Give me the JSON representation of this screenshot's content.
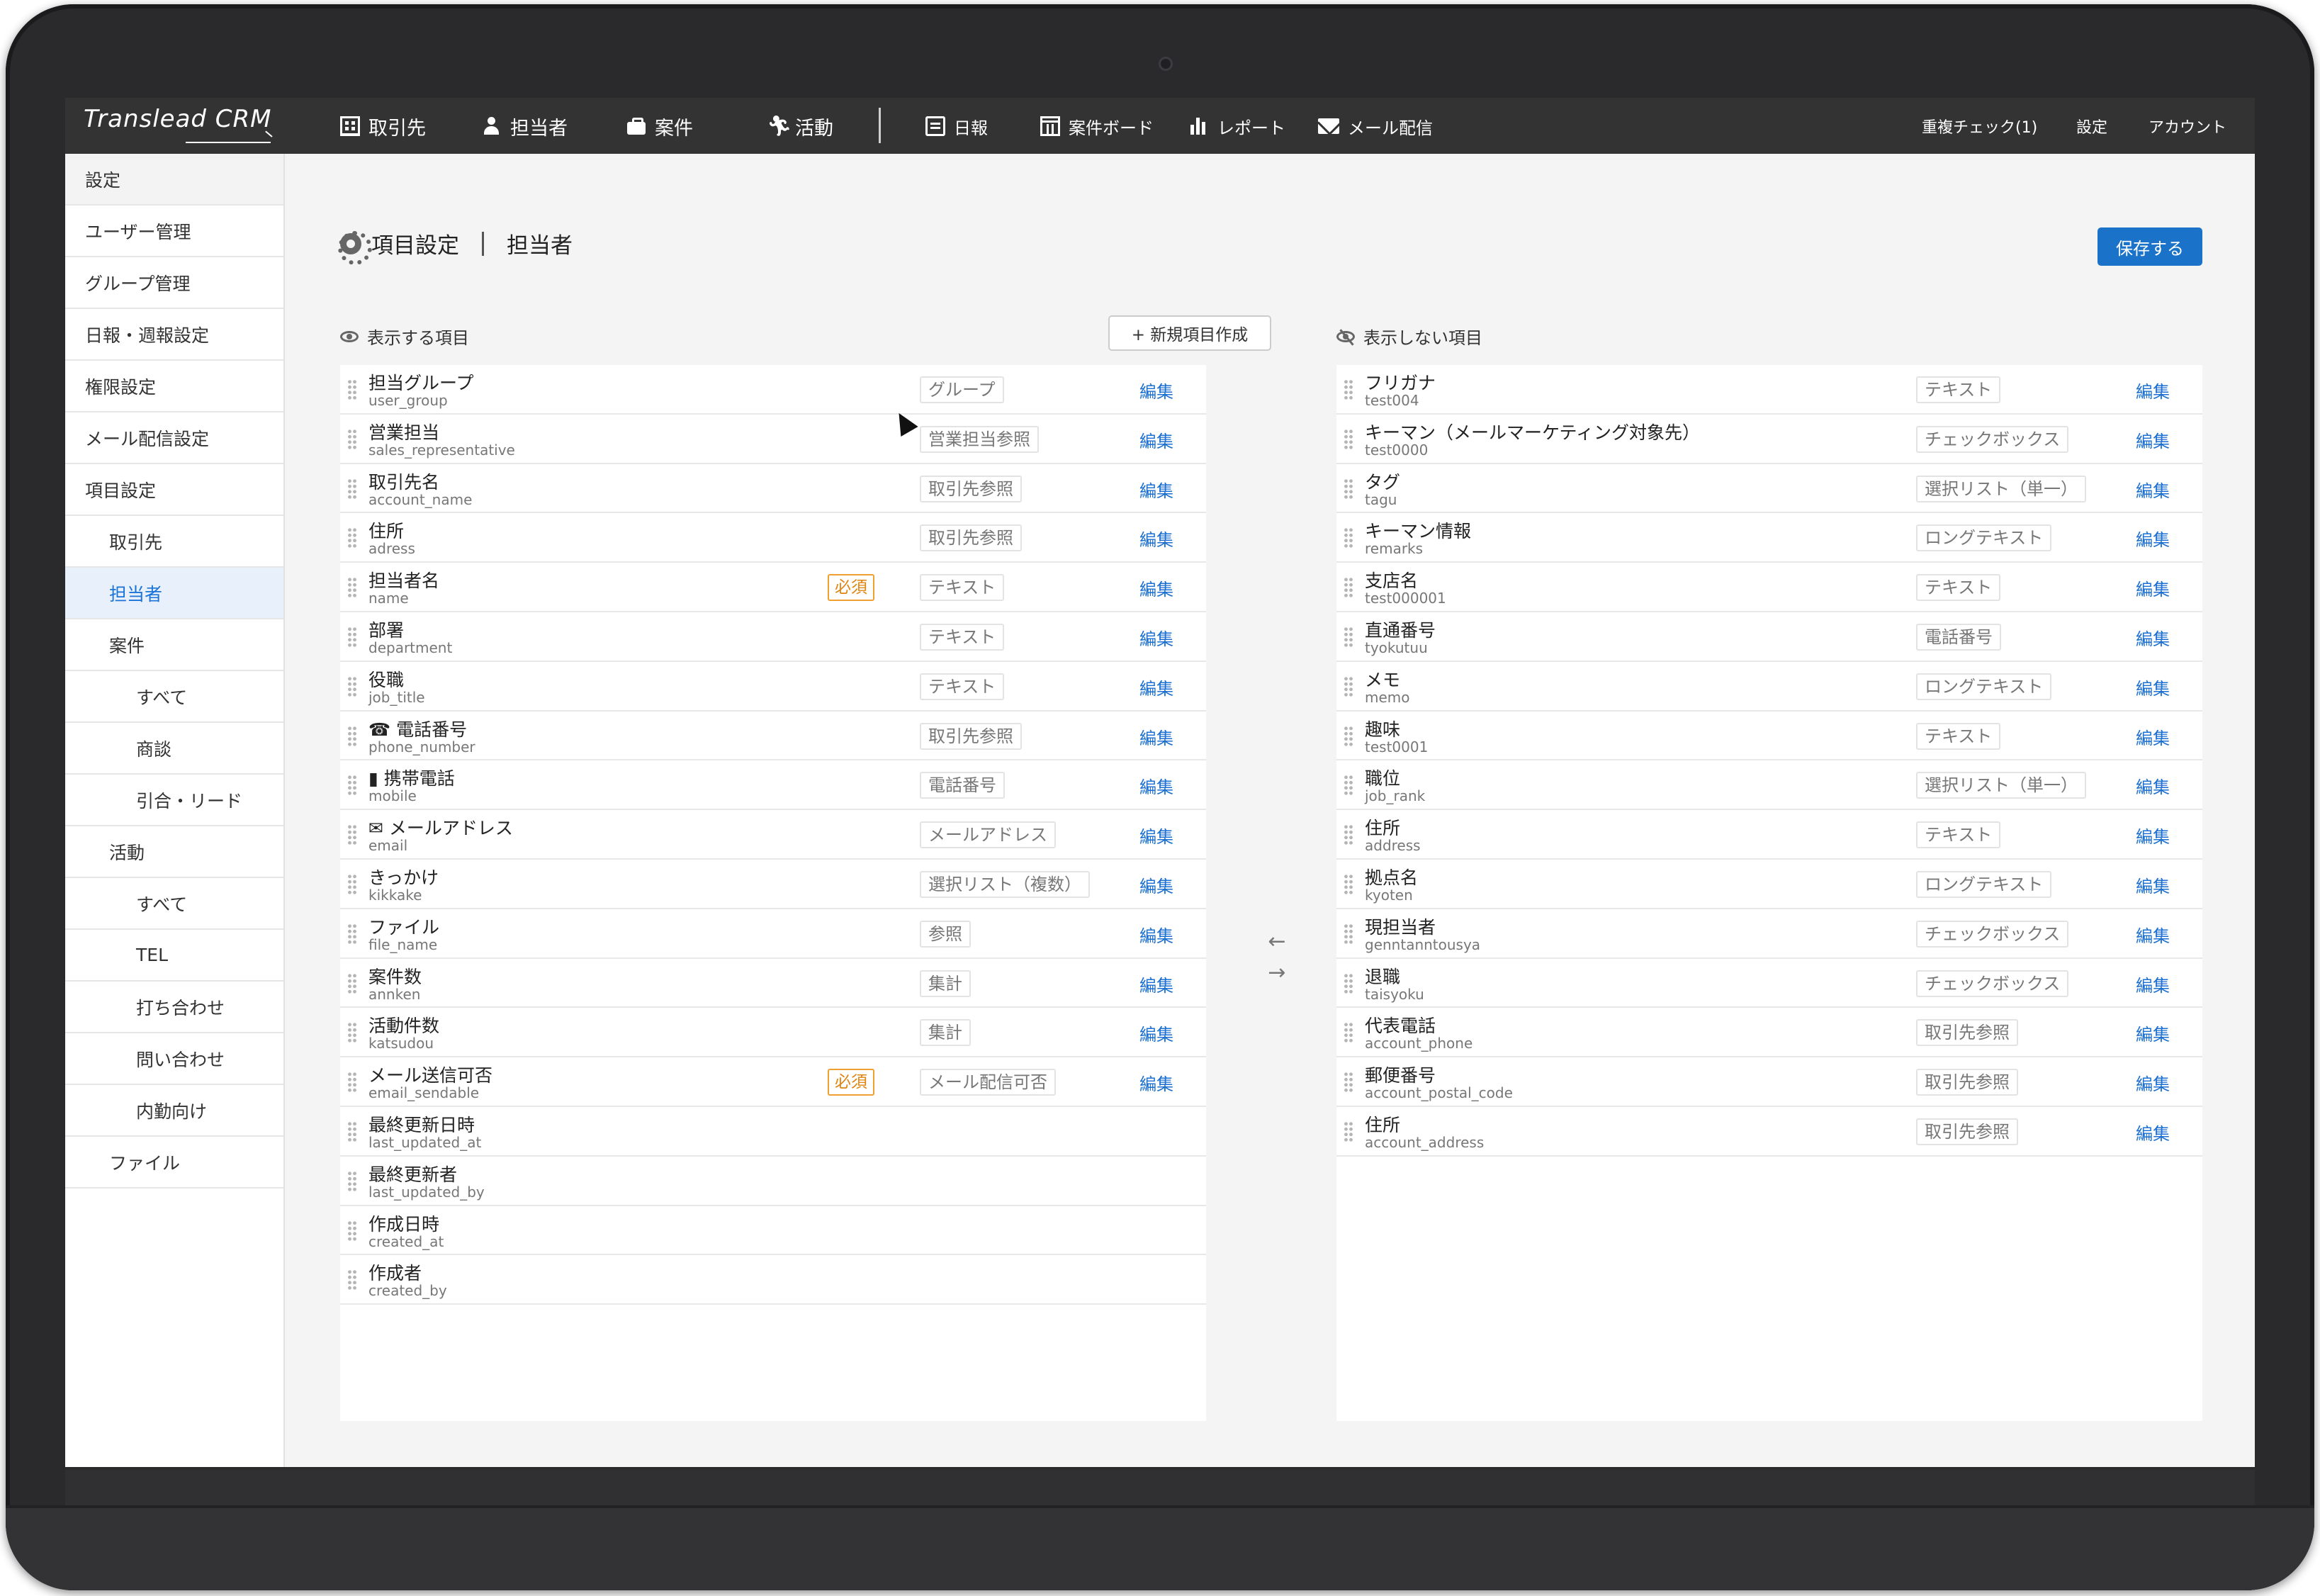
{
  "app": {
    "logo": "Translead CRM"
  },
  "nav": {
    "items": [
      {
        "label": "取引先",
        "icon": "building-icon"
      },
      {
        "label": "担当者",
        "icon": "person-icon"
      },
      {
        "label": "案件",
        "icon": "briefcase-icon"
      },
      {
        "label": "活動",
        "icon": "running-icon"
      },
      {
        "label": "日報",
        "icon": "note-icon"
      },
      {
        "label": "案件ボード",
        "icon": "board-icon"
      },
      {
        "label": "レポート",
        "icon": "chart-icon"
      },
      {
        "label": "メール配信",
        "icon": "mail-icon"
      }
    ],
    "right": [
      "重複チェック(1)",
      "設定",
      "アカウント"
    ]
  },
  "sidebar": {
    "items": [
      {
        "label": "設定"
      },
      {
        "label": "ユーザー管理"
      },
      {
        "label": "グループ管理"
      },
      {
        "label": "日報・週報設定"
      },
      {
        "label": "権限設定"
      },
      {
        "label": "メール配信設定"
      },
      {
        "label": "項目設定"
      },
      {
        "label": "取引先"
      },
      {
        "label": "担当者"
      },
      {
        "label": "案件"
      },
      {
        "label": "すべて"
      },
      {
        "label": "商談"
      },
      {
        "label": "引合・リード"
      },
      {
        "label": "活動"
      },
      {
        "label": "すべて"
      },
      {
        "label": "TEL"
      },
      {
        "label": "打ち合わせ"
      },
      {
        "label": "問い合わせ"
      },
      {
        "label": "内勤向け"
      },
      {
        "label": "ファイル"
      }
    ]
  },
  "page": {
    "title": "項目設定",
    "subtitle": "担当者",
    "save_label": "保存する",
    "visible_heading": "表示する項目",
    "new_item_label": "+ 新規項目作成",
    "hidden_heading": "表示しない項目",
    "edit_label": "編集",
    "required_label": "必須"
  },
  "visible_fields": [
    {
      "name": "担当グループ",
      "key": "user_group",
      "type": "グループ",
      "required": false,
      "editable": true
    },
    {
      "name": "営業担当",
      "key": "sales_representative",
      "type": "営業担当参照",
      "required": false,
      "editable": true
    },
    {
      "name": "取引先名",
      "key": "account_name",
      "type": "取引先参照",
      "required": false,
      "editable": true
    },
    {
      "name": "住所",
      "key": "adress",
      "type": "取引先参照",
      "required": false,
      "editable": true
    },
    {
      "name": "担当者名",
      "key": "name",
      "type": "テキスト",
      "required": true,
      "editable": true
    },
    {
      "name": "部署",
      "key": "department",
      "type": "テキスト",
      "required": false,
      "editable": true
    },
    {
      "name": "役職",
      "key": "job_title",
      "type": "テキスト",
      "required": false,
      "editable": true
    },
    {
      "name": "☎ 電話番号",
      "key": "phone_number",
      "type": "取引先参照",
      "required": false,
      "editable": true
    },
    {
      "name": "▮ 携帯電話",
      "key": "mobile",
      "type": "電話番号",
      "required": false,
      "editable": true
    },
    {
      "name": "✉ メールアドレス",
      "key": "email",
      "type": "メールアドレス",
      "required": false,
      "editable": true
    },
    {
      "name": "きっかけ",
      "key": "kikkake",
      "type": "選択リスト（複数）",
      "required": false,
      "editable": true
    },
    {
      "name": "ファイル",
      "key": "file_name",
      "type": "参照",
      "required": false,
      "editable": true
    },
    {
      "name": "案件数",
      "key": "annken",
      "type": "集計",
      "required": false,
      "editable": true
    },
    {
      "name": "活動件数",
      "key": "katsudou",
      "type": "集計",
      "required": false,
      "editable": true
    },
    {
      "name": "メール送信可否",
      "key": "email_sendable",
      "type": "メール配信可否",
      "required": true,
      "editable": true
    },
    {
      "name": "最終更新日時",
      "key": "last_updated_at",
      "type": "",
      "required": false,
      "editable": false
    },
    {
      "name": "最終更新者",
      "key": "last_updated_by",
      "type": "",
      "required": false,
      "editable": false
    },
    {
      "name": "作成日時",
      "key": "created_at",
      "type": "",
      "required": false,
      "editable": false
    },
    {
      "name": "作成者",
      "key": "created_by",
      "type": "",
      "required": false,
      "editable": false
    }
  ],
  "hidden_fields": [
    {
      "name": "フリガナ",
      "key": "test004",
      "type": "テキスト"
    },
    {
      "name": "キーマン（メールマーケティング対象先）",
      "key": "test0000",
      "type": "チェックボックス"
    },
    {
      "name": "タグ",
      "key": "tagu",
      "type": "選択リスト（単一）"
    },
    {
      "name": "キーマン情報",
      "key": "remarks",
      "type": "ロングテキスト"
    },
    {
      "name": "支店名",
      "key": "test000001",
      "type": "テキスト"
    },
    {
      "name": "直通番号",
      "key": "tyokutuu",
      "type": "電話番号"
    },
    {
      "name": "メモ",
      "key": "memo",
      "type": "ロングテキスト"
    },
    {
      "name": "趣味",
      "key": "test0001",
      "type": "テキスト"
    },
    {
      "name": "職位",
      "key": "job_rank",
      "type": "選択リスト（単一）"
    },
    {
      "name": "住所",
      "key": "address",
      "type": "テキスト"
    },
    {
      "name": "拠点名",
      "key": "kyoten",
      "type": "ロングテキスト"
    },
    {
      "name": "現担当者",
      "key": "genntanntousya",
      "type": "チェックボックス"
    },
    {
      "name": "退職",
      "key": "taisyoku",
      "type": "チェックボックス"
    },
    {
      "name": "代表電話",
      "key": "account_phone",
      "type": "取引先参照"
    },
    {
      "name": "郵便番号",
      "key": "account_postal_code",
      "type": "取引先参照"
    },
    {
      "name": "住所",
      "key": "account_address",
      "type": "取引先参照"
    }
  ],
  "colors": {
    "accent": "#1a73c9",
    "link": "#1a6fd0",
    "required": "#e08410",
    "navbar": "#333333"
  }
}
